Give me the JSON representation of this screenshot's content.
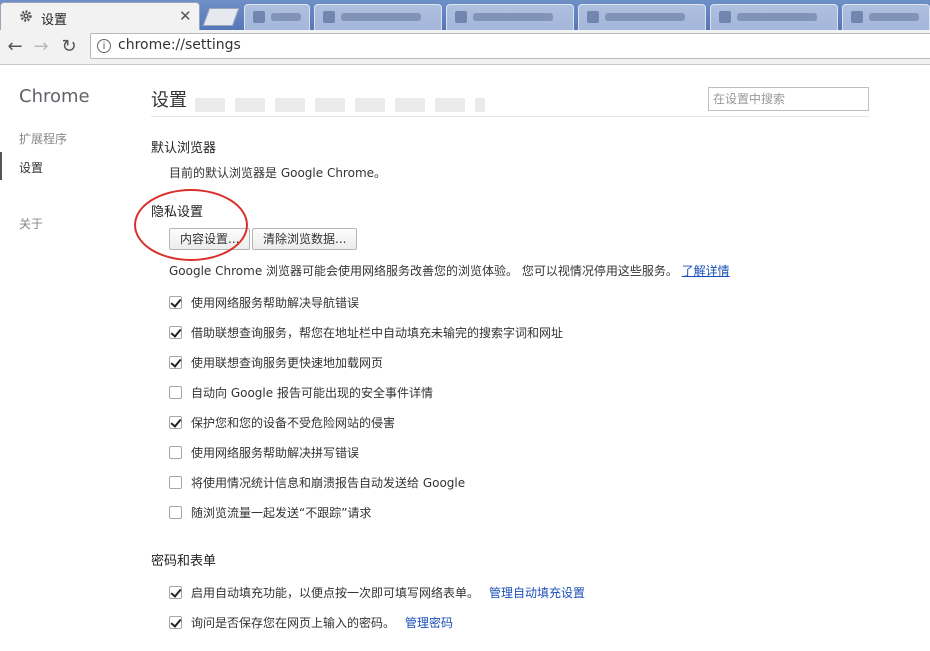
{
  "tabs": {
    "active_title": "设置"
  },
  "toolbar": {
    "url": "chrome://settings"
  },
  "sidebar": {
    "title": "Chrome",
    "items": [
      {
        "label": "扩展程序"
      },
      {
        "label": "设置"
      },
      {
        "label": "关于"
      }
    ]
  },
  "main": {
    "title": "设置",
    "search_placeholder": "在设置中搜索",
    "default_browser": {
      "heading": "默认浏览器",
      "text": "目前的默认浏览器是 Google Chrome。"
    },
    "privacy": {
      "heading": "隐私设置",
      "content_settings_button": "内容设置...",
      "clear_data_button": "清除浏览数据...",
      "description": "Google Chrome 浏览器可能会使用网络服务改善您的浏览体验。 您可以视情况停用这些服务。",
      "learn_more": "了解详情",
      "options": [
        {
          "label": "使用网络服务帮助解决导航错误",
          "checked": true
        },
        {
          "label": "借助联想查询服务，帮您在地址栏中自动填充未输完的搜索字词和网址",
          "checked": true
        },
        {
          "label": "使用联想查询服务更快速地加载网页",
          "checked": true
        },
        {
          "label": "自动向 Google 报告可能出现的安全事件详情",
          "checked": false
        },
        {
          "label": "保护您和您的设备不受危险网站的侵害",
          "checked": true
        },
        {
          "label": "使用网络服务帮助解决拼写错误",
          "checked": false
        },
        {
          "label": "将使用情况统计信息和崩溃报告自动发送给 Google",
          "checked": false
        },
        {
          "label": "随浏览流量一起发送“不跟踪”请求",
          "checked": false
        }
      ]
    },
    "passwords": {
      "heading": "密码和表单",
      "options": [
        {
          "label": "启用自动填充功能，以便点按一次即可填写网络表单。",
          "checked": true,
          "link": "管理自动填充设置"
        },
        {
          "label": "询问是否保存您在网页上输入的密码。",
          "checked": true,
          "link": "管理密码"
        }
      ]
    }
  }
}
